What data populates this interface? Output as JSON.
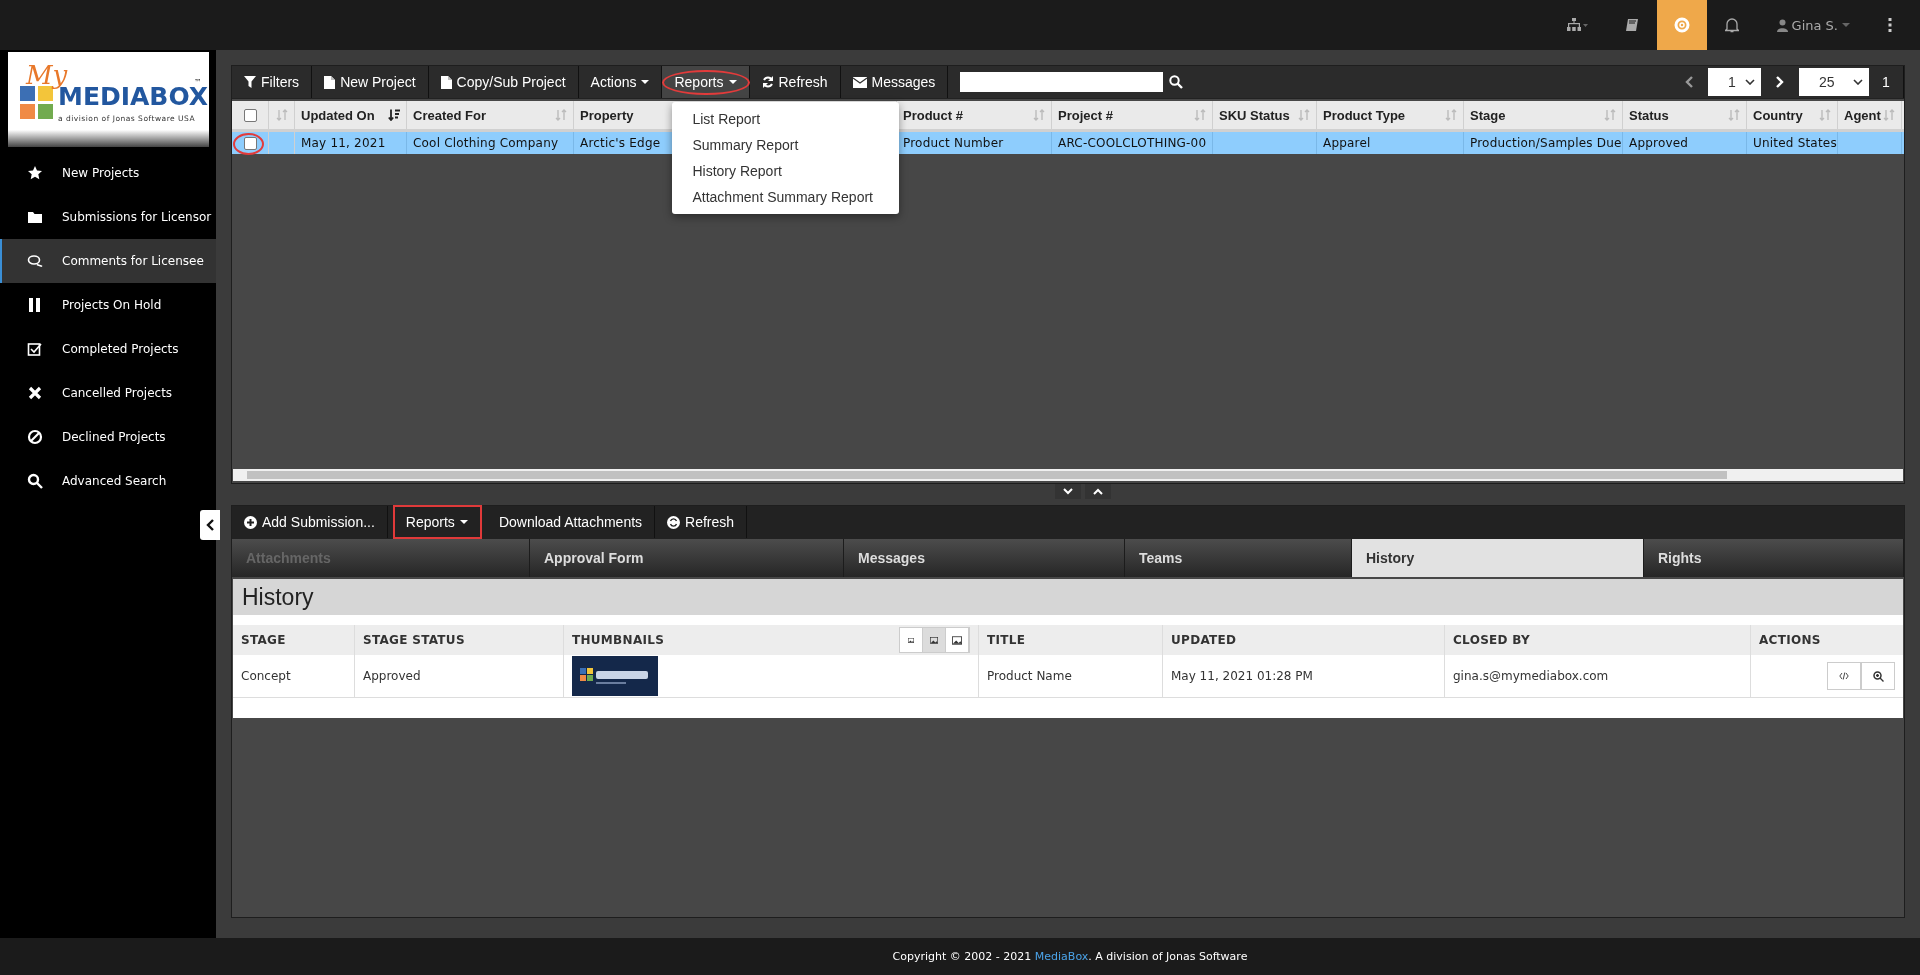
{
  "topbar": {
    "help_active": true,
    "user": "Gina S."
  },
  "logo": {
    "script": "My",
    "name": "MEDIABOX",
    "mark": "™",
    "tagline": "a division of Jonas Software USA"
  },
  "sidebar": {
    "items": [
      {
        "label": "New Projects",
        "selected": false
      },
      {
        "label": "Submissions for Licensor",
        "selected": false
      },
      {
        "label": "Comments for Licensee",
        "selected": true
      },
      {
        "label": "Projects On Hold",
        "selected": false
      },
      {
        "label": "Completed Projects",
        "selected": false
      },
      {
        "label": "Cancelled Projects",
        "selected": false
      },
      {
        "label": "Declined Projects",
        "selected": false
      },
      {
        "label": "Advanced Search",
        "selected": false
      }
    ]
  },
  "toolbar": {
    "buttons": [
      {
        "label": "Filters",
        "highlighted": false
      },
      {
        "label": "New Project",
        "highlighted": false
      },
      {
        "label": "Copy/Sub Project",
        "highlighted": false
      },
      {
        "label": "Actions",
        "highlighted": false
      },
      {
        "label": "Reports",
        "highlighted": true
      },
      {
        "label": "Refresh",
        "highlighted": false
      },
      {
        "label": "Messages",
        "highlighted": false
      }
    ],
    "reports_menu": [
      "List Report",
      "Summary Report",
      "History Report",
      "Attachment Summary Report"
    ],
    "page": "1",
    "page_size": "25",
    "page_count": "1"
  },
  "table": {
    "select_all_checked": false,
    "columns": [
      {
        "label": "Updated On",
        "sorted": true
      },
      {
        "label": "Created For",
        "sorted": false
      },
      {
        "label": "Property"
      },
      {
        "label": "Product #",
        "sorted": false
      },
      {
        "label": "Project #",
        "sorted": false
      },
      {
        "label": "SKU Status",
        "sorted": false
      },
      {
        "label": "Product Type",
        "sorted": false
      },
      {
        "label": "Stage",
        "sorted": false
      },
      {
        "label": "Status",
        "sorted": false
      },
      {
        "label": "Country",
        "sorted": false
      },
      {
        "label": "Agent",
        "sorted": false
      }
    ],
    "rows": [
      {
        "selected": true,
        "checked": false,
        "highlighted": true,
        "cells": [
          "May 11, 2021",
          "Cool Clothing Company",
          "Arctic's Edge",
          "Product Number",
          "ARC-COOLCLOTHING-00",
          "",
          "Apparel",
          "Production/Samples Due",
          "Approved",
          "United States",
          ""
        ]
      }
    ]
  },
  "detail_toolbar": {
    "buttons": [
      {
        "label": "Add Submission...",
        "highlighted": false
      },
      {
        "label": "Reports",
        "highlighted": true
      },
      {
        "label": "Download Attachments",
        "highlighted": false
      },
      {
        "label": "Refresh",
        "highlighted": false
      }
    ]
  },
  "tabs": [
    {
      "label": "Attachments",
      "selected": false,
      "disabled": true
    },
    {
      "label": "Approval Form",
      "selected": false,
      "disabled": false
    },
    {
      "label": "Messages",
      "selected": false,
      "disabled": false
    },
    {
      "label": "Teams",
      "selected": false,
      "disabled": false
    },
    {
      "label": "History",
      "selected": true,
      "disabled": false
    },
    {
      "label": "Rights",
      "selected": false,
      "disabled": false
    }
  ],
  "history": {
    "title": "History",
    "columns": [
      "STAGE",
      "STAGE STATUS",
      "THUMBNAILS",
      "TITLE",
      "UPDATED",
      "CLOSED BY",
      "ACTIONS"
    ],
    "thumbnail_sizes": [
      {
        "selected": false
      },
      {
        "selected": true
      },
      {
        "selected": false
      }
    ],
    "rows": [
      {
        "stage": "Concept",
        "stage_status": "Approved",
        "title": "Product Name",
        "updated": "May 11, 2021 01:28 PM",
        "closed_by": "gina.s@mymediabox.com"
      }
    ]
  },
  "footer": {
    "before": "Copyright © 2002 - 2021 ",
    "link": "MediaBox",
    "after": ". A division of Jonas Software"
  }
}
